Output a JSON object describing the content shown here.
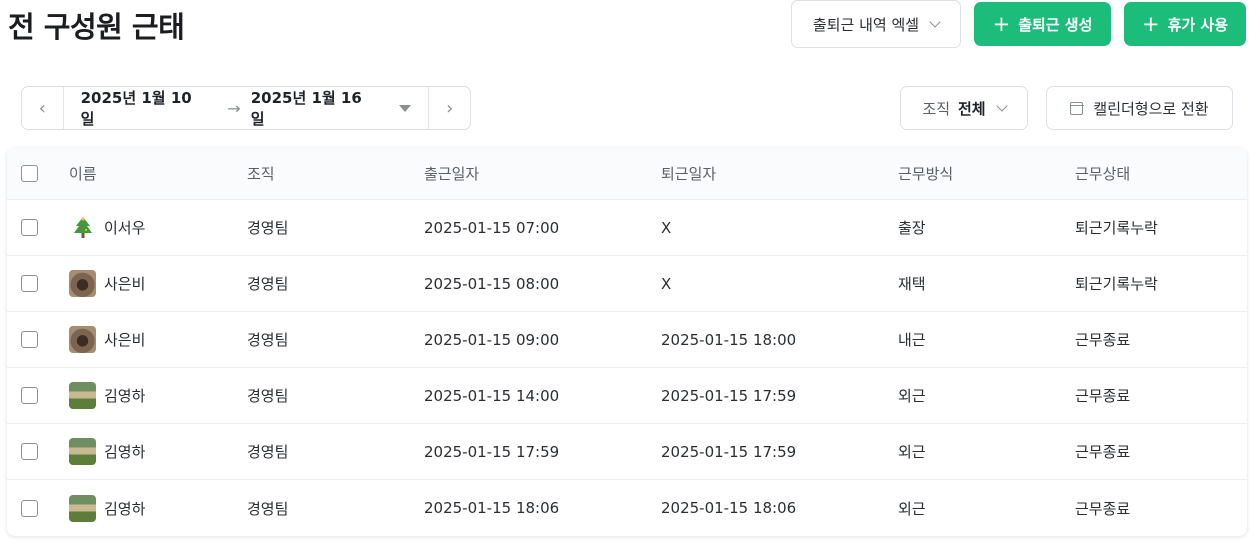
{
  "page": {
    "title": "전 구성원 근태"
  },
  "toolbar": {
    "export_label": "출퇴근 내역 엑셀",
    "create_label": "출퇴근 생성",
    "leave_label": "휴가 사용",
    "plus_symbol": "+"
  },
  "date_range": {
    "start": "2025년 1월 10일",
    "end": "2025년 1월 16일",
    "prev_symbol": "‹",
    "next_symbol": "›",
    "arrow_symbol": "→"
  },
  "filters": {
    "org_label": "조직",
    "org_value": "전체",
    "calendar_label": "캘린더형으로 전환"
  },
  "table": {
    "headers": [
      "이름",
      "조직",
      "출근일자",
      "퇴근일자",
      "근무방식",
      "근무상태"
    ],
    "rows": [
      {
        "avatar": "tree",
        "name": "이서우",
        "org": "경영팀",
        "clock_in": "2025-01-15 07:00",
        "clock_out": "X",
        "work_type": "출장",
        "status": "퇴근기록누락"
      },
      {
        "avatar": "dog",
        "name": "사은비",
        "org": "경영팀",
        "clock_in": "2025-01-15 08:00",
        "clock_out": "X",
        "work_type": "재택",
        "status": "퇴근기록누락"
      },
      {
        "avatar": "dog",
        "name": "사은비",
        "org": "경영팀",
        "clock_in": "2025-01-15 09:00",
        "clock_out": "2025-01-15 18:00",
        "work_type": "내근",
        "status": "근무종료"
      },
      {
        "avatar": "house",
        "name": "김영하",
        "org": "경영팀",
        "clock_in": "2025-01-15 14:00",
        "clock_out": "2025-01-15 17:59",
        "work_type": "외근",
        "status": "근무종료"
      },
      {
        "avatar": "house",
        "name": "김영하",
        "org": "경영팀",
        "clock_in": "2025-01-15 17:59",
        "clock_out": "2025-01-15 17:59",
        "work_type": "외근",
        "status": "근무종료"
      },
      {
        "avatar": "house",
        "name": "김영하",
        "org": "경영팀",
        "clock_in": "2025-01-15 18:06",
        "clock_out": "2025-01-15 18:06",
        "work_type": "외근",
        "status": "근무종료"
      }
    ]
  },
  "colors": {
    "accent": "#1cbc7a",
    "border": "#dcdfe3",
    "text": "#1f2329"
  }
}
